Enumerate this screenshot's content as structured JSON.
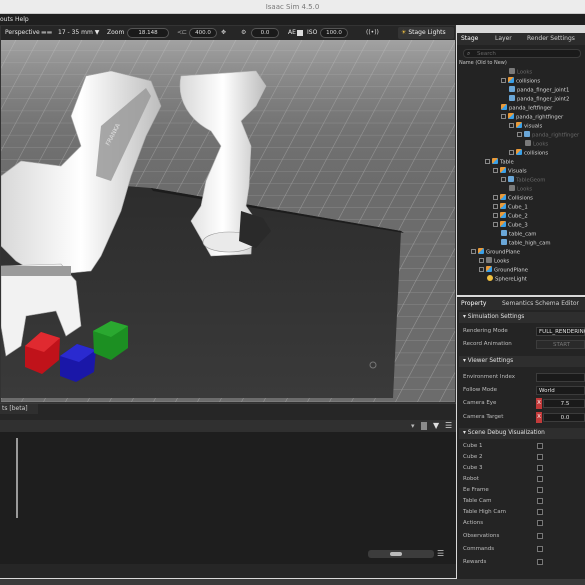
{
  "window": {
    "title": "Isaac Sim 4.5.0"
  },
  "menubar": {
    "items": [
      "outs",
      "Help"
    ]
  },
  "viewport_toolbar": {
    "camera": "Perspective",
    "lens": "17 - 35 mm",
    "zoom_label": "Zoom",
    "zoom_value": "18.148",
    "speed_value": "400.0",
    "rotation_value": "0.0",
    "ae_label": "AE",
    "iso_label": "ISO",
    "iso_value": "100.0",
    "stage_lights": "Stage Lights"
  },
  "scene": {
    "robot_brand": "FRANKA"
  },
  "console": {
    "tab_label": "ts [beta]"
  },
  "right_panel": {
    "tabs": [
      "Stage",
      "Layer",
      "Render Settings"
    ],
    "search_placeholder": "Search",
    "tree_header": "Name (Old to New)",
    "tree": [
      {
        "label": "Looks",
        "dim": true
      },
      {
        "label": "collisions"
      },
      {
        "label": "panda_finger_joint1"
      },
      {
        "label": "panda_finger_joint2"
      },
      {
        "label": "panda_leftfinger"
      },
      {
        "label": "panda_rightfinger"
      },
      {
        "label": "visuals"
      },
      {
        "label": "panda_rightfinger",
        "dim": true
      },
      {
        "label": "Looks",
        "dim": true
      },
      {
        "label": "collisions"
      },
      {
        "label": "Table"
      },
      {
        "label": "Visuals"
      },
      {
        "label": "TableGeom",
        "dim": true
      },
      {
        "label": "Looks",
        "dim": true
      },
      {
        "label": "Collisions"
      },
      {
        "label": "Cube_1"
      },
      {
        "label": "Cube_2"
      },
      {
        "label": "Cube_3"
      },
      {
        "label": "table_cam"
      },
      {
        "label": "table_high_cam"
      },
      {
        "label": "GroundPlane"
      },
      {
        "label": "Looks"
      },
      {
        "label": "GroundPlane"
      },
      {
        "label": "SphereLight"
      }
    ]
  },
  "property_panel": {
    "tabs": [
      "Property",
      "Semantics Schema Editor"
    ],
    "simulation_settings": {
      "title": "Simulation Settings",
      "rendering_mode_label": "Rendering Mode",
      "rendering_mode_value": "FULL_RENDERING",
      "record_animation_label": "Record Animation",
      "record_button": "START"
    },
    "viewer_settings": {
      "title": "Viewer Settings",
      "env_index_label": "Environment Index",
      "follow_mode_label": "Follow Mode",
      "follow_mode_value": "World",
      "camera_eye_label": "Camera Eye",
      "camera_eye_x": "7.5",
      "camera_target_label": "Camera Target",
      "camera_target_x": "0.0",
      "axis_x": "X"
    },
    "scene_debug": {
      "title": "Scene Debug Visualization",
      "items": [
        "Cube 1",
        "Cube 2",
        "Cube 3",
        "Robot",
        "Ee Frame",
        "Table Cam",
        "Table High Cam",
        "Actions",
        "Observations",
        "Commands",
        "Rewards"
      ]
    }
  },
  "colors": {
    "accent": "#76b900",
    "cube_red": "#c0121a",
    "cube_blue": "#1a17a8",
    "cube_green": "#1c8f22"
  }
}
